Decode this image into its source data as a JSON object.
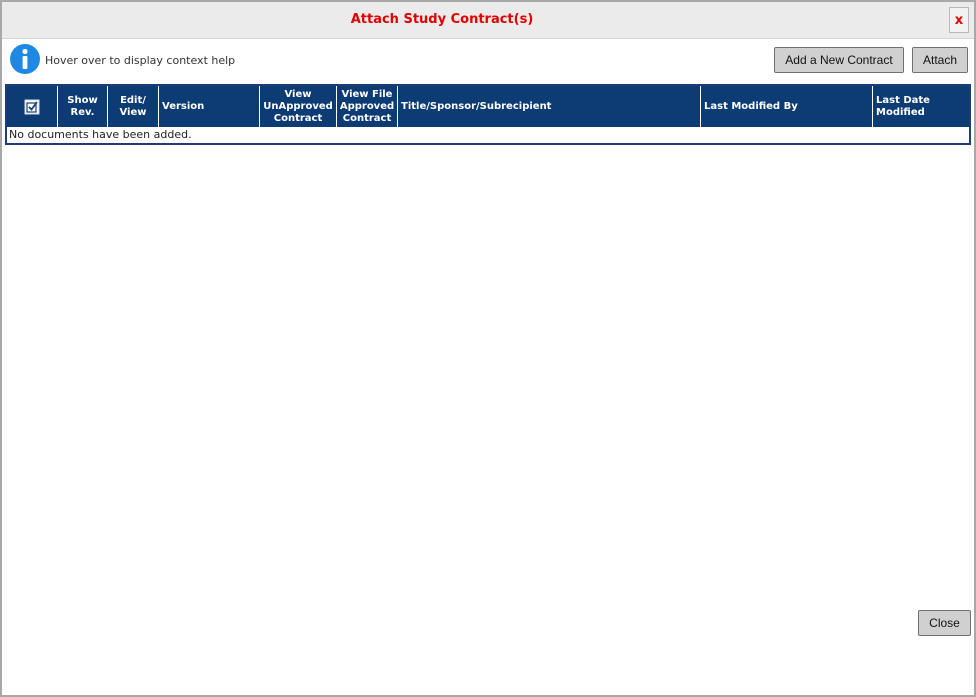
{
  "dialog": {
    "title": "Attach Study Contract(s)",
    "close_x_label": "x",
    "help_text": "Hover over to display context help",
    "buttons": {
      "add_new_contract": "Add a New Contract",
      "attach": "Attach",
      "close": "Close"
    }
  },
  "table": {
    "columns": [
      {
        "key": "select",
        "label": "",
        "icon": "select-all-checkbox-icon"
      },
      {
        "key": "show_rev",
        "label": "Show\nRev."
      },
      {
        "key": "edit_view",
        "label": "Edit/\nView"
      },
      {
        "key": "version",
        "label": "Version"
      },
      {
        "key": "view_unapproved",
        "label": "View\nUnApproved\nContract"
      },
      {
        "key": "view_approved",
        "label": "View File\nApproved\nContract"
      },
      {
        "key": "title",
        "label": "Title/Sponsor/Subrecipient"
      },
      {
        "key": "last_modified_by",
        "label": "Last Modified By"
      },
      {
        "key": "last_date_modified",
        "label": "Last Date\nModified"
      }
    ],
    "empty_message": "No documents have been added."
  },
  "colors": {
    "title": "#e00000",
    "header_bg": "#0d3b73",
    "info_icon": "#1e88e5"
  },
  "icons": [
    "info-icon",
    "select-all-checkbox-icon",
    "close-icon"
  ]
}
